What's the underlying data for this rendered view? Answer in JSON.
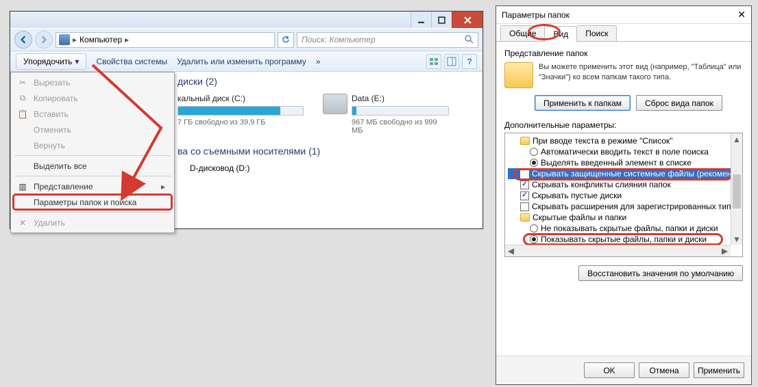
{
  "explorer": {
    "breadcrumb": "Компьютер",
    "search_placeholder": "Поиск: Компьютер",
    "toolbar": {
      "organize": "Упорядочить",
      "system_props": "Свойства системы",
      "uninstall": "Удалить или изменить программу",
      "more": "»"
    },
    "menu": {
      "cut": "Вырезать",
      "copy": "Копировать",
      "paste": "Вставить",
      "undo": "Отменить",
      "redo": "Вернуть",
      "select_all": "Выделить все",
      "layout": "Представление",
      "folder_options": "Параметры папок и поиска",
      "delete": "Удалить"
    },
    "sections": {
      "disks_header": "диски (2)",
      "removable_header": "ва со съемными носителями (1)"
    },
    "disks": [
      {
        "label": "кальный диск (C:)",
        "info": "7 ГБ свободно из 39,9 ГБ",
        "fill_pct": 82,
        "fill_color": "#29a6d6"
      },
      {
        "label": "Data (E:)",
        "info": "967 МБ свободно из 999 МБ",
        "fill_pct": 4,
        "fill_color": "#29a6d6"
      }
    ],
    "cd_label": "D-дисковод (D:)"
  },
  "fopts": {
    "title": "Параметры папок",
    "close": "✕",
    "tabs": {
      "general": "Общие",
      "view": "Вид",
      "search": "Поиск"
    },
    "view_group_label": "Представление папок",
    "view_desc": "Вы можете применить этот вид (например, \"Таблица\" или \"Значки\") ко всем папкам такого типа.",
    "btn_apply_folders": "Применить к папкам",
    "btn_reset_folders": "Сброс вида папок",
    "adv_label": "Дополнительные параметры:",
    "tree": {
      "group_input": "При вводе текста в режиме \"Список\"",
      "auto_type": "Автоматически вводить текст в поле поиска",
      "select_typed": "Выделять введенный элемент в списке",
      "hide_protected": "Скрывать защищенные системные файлы (рекомен.",
      "hide_merge": "Скрывать конфликты слияния папок",
      "hide_empty": "Скрывать пустые диски",
      "hide_ext": "Скрывать расширения для зарегистрированных типо",
      "group_hidden": "Скрытые файлы и папки",
      "dont_show": "Не показывать скрытые файлы, папки и диски",
      "show_hidden": "Показывать скрытые файлы, папки и диски"
    },
    "btn_restore": "Восстановить значения по умолчанию",
    "btn_ok": "OK",
    "btn_cancel": "Отмена",
    "btn_apply": "Применить"
  }
}
